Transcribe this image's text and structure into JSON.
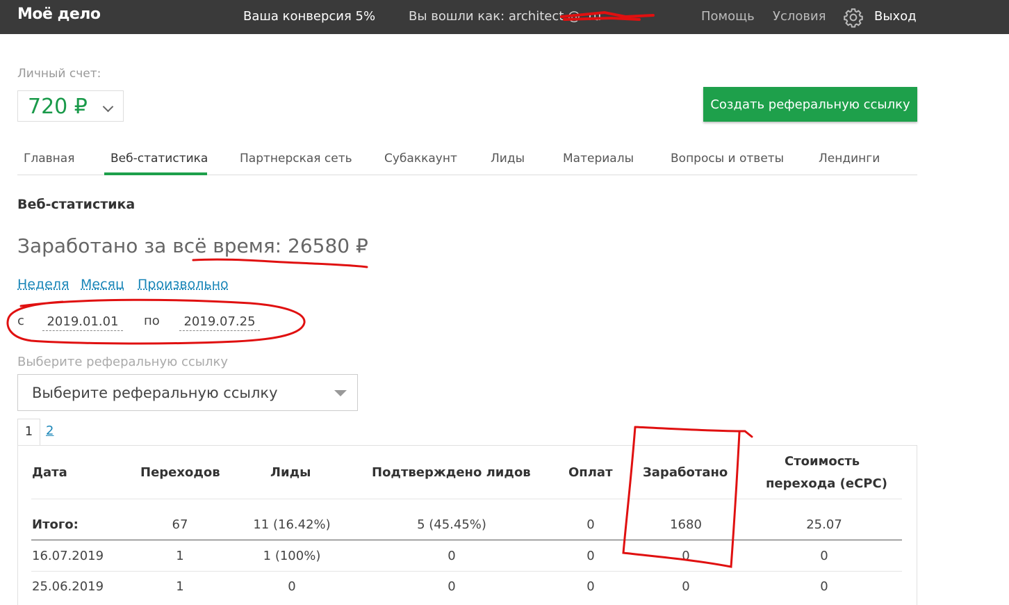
{
  "topbar": {
    "logo": "Моё дело",
    "conversion": "Ваша конверсия 5%",
    "logged_in": "Вы вошли как: architect        @              .ru",
    "help": "Помощь",
    "terms": "Условия",
    "gear_icon": "gear-icon",
    "logout": "Выход"
  },
  "account": {
    "label": "Личный счет:",
    "balance": "720 ₽"
  },
  "create_button": "Создать реферальную ссылку",
  "tabs": [
    "Главная",
    "Веб-статистика",
    "Партнерская сеть",
    "Субаккаунт",
    "Лиды",
    "Материалы",
    "Вопросы и ответы",
    "Лендинги"
  ],
  "active_tab": "Веб-статистика",
  "section_title": "Веб-статистика",
  "earned_total": "Заработано за всё время: 26580 ₽",
  "periods": [
    "Неделя",
    "Месяц",
    "Произвольно"
  ],
  "date_range": {
    "from_label": "с",
    "from": "2019.01.01",
    "to_label": "по",
    "to": "2019.07.25"
  },
  "referral": {
    "label": "Выберите реферальную ссылку",
    "selected": "Выберите реферальную ссылку"
  },
  "pagination": [
    "1",
    "2"
  ],
  "table": {
    "headers": [
      "Дата",
      "Переходов",
      "Лиды",
      "Подтверждено лидов",
      "Оплат",
      "Заработано",
      "Стоимость перехода (eCPC)"
    ],
    "header_ecpc_line1": "Стоимость",
    "header_ecpc_line2": "перехода (eCPC)",
    "total": {
      "label": "Итого:",
      "clicks": "67",
      "leads": "11  (16.42%)",
      "confirmed": "5  (45.45%)",
      "payments": "0",
      "earned": "1680",
      "ecpc": "25.07"
    },
    "rows": [
      {
        "date": "16.07.2019",
        "clicks": "1",
        "leads": "1  (100%)",
        "confirmed": "0",
        "payments": "0",
        "earned": "0",
        "ecpc": "0"
      },
      {
        "date": "25.06.2019",
        "clicks": "1",
        "leads": "0",
        "confirmed": "0",
        "payments": "0",
        "earned": "0",
        "ecpc": "0"
      }
    ]
  },
  "colors": {
    "topbar": "#3a3a3a",
    "accent_green": "#1ea04b",
    "link_blue": "#1a86b8",
    "annotation_red": "#e01010"
  }
}
